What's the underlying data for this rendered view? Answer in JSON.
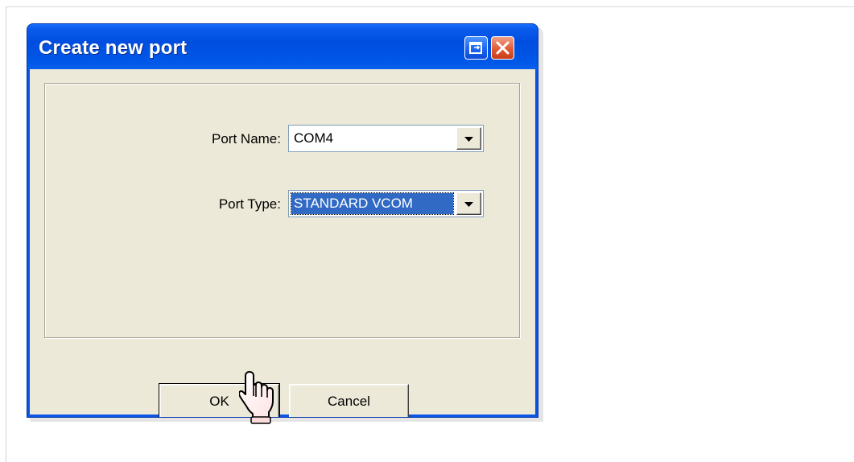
{
  "dialog": {
    "title": "Create new port",
    "port_name": {
      "label": "Port Name:",
      "value": "COM4"
    },
    "port_type": {
      "label": "Port Type:",
      "value": "STANDARD VCOM"
    },
    "buttons": {
      "ok": "OK",
      "cancel": "Cancel"
    }
  },
  "colors": {
    "titlebar": "#0054e3",
    "client": "#ece9d8",
    "selection": "#316ac5",
    "close_button": "#e25b36"
  },
  "icons": {
    "restore": "restore-window-icon",
    "close": "close-icon",
    "dropdown": "chevron-down-icon",
    "cursor": "hand-pointer-icon"
  }
}
